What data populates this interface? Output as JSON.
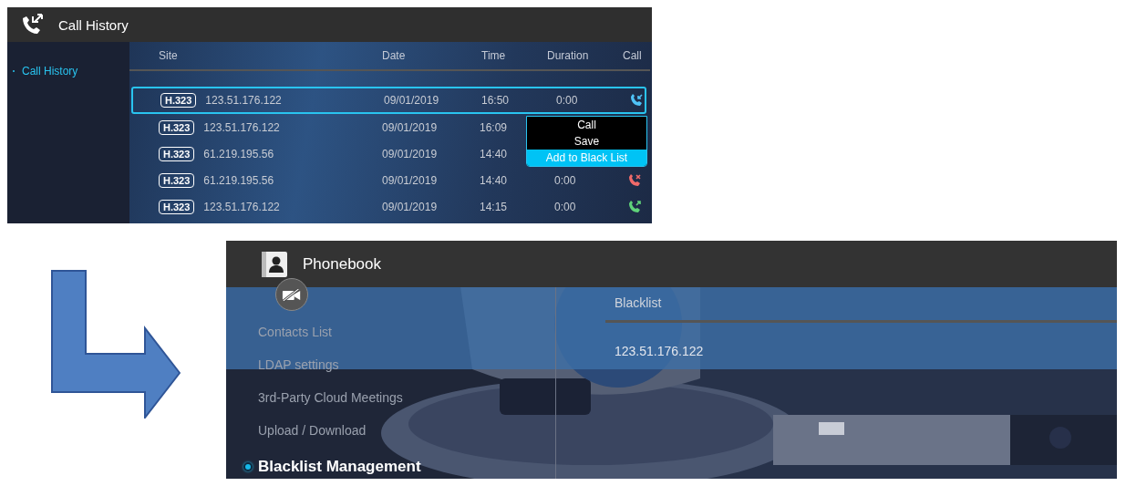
{
  "call_history": {
    "title": "Call History",
    "sidebar": [
      {
        "label": "Call History",
        "selected": true
      }
    ],
    "columns": [
      "Site",
      "Date",
      "Time",
      "Duration",
      "Call"
    ],
    "rows": [
      {
        "protocol": "H.323",
        "site": "123.51.176.122",
        "date": "09/01/2019",
        "time": "16:50",
        "duration": "0:00",
        "kind": "incoming",
        "selected": true
      },
      {
        "protocol": "H.323",
        "site": "123.51.176.122",
        "date": "09/01/2019",
        "time": "16:09",
        "selected": false
      },
      {
        "protocol": "H.323",
        "site": "61.219.195.56",
        "date": "09/01/2019",
        "time": "14:40",
        "selected": false
      },
      {
        "protocol": "H.323",
        "site": "61.219.195.56",
        "date": "09/01/2019",
        "time": "14:40",
        "duration": "0:00",
        "kind": "missed",
        "selected": false
      },
      {
        "protocol": "H.323",
        "site": "123.51.176.122",
        "date": "09/01/2019",
        "time": "14:15",
        "duration": "0:00",
        "kind": "outgoing",
        "selected": false
      }
    ],
    "context_menu": [
      {
        "label": "Call",
        "selected": false
      },
      {
        "label": "Save",
        "selected": false
      },
      {
        "label": "Add to Black List",
        "selected": true
      }
    ]
  },
  "phonebook": {
    "title": "Phonebook",
    "sidebar": [
      {
        "label": "Contacts List",
        "selected": false
      },
      {
        "label": "LDAP settings",
        "selected": false
      },
      {
        "label": "3rd-Party Cloud Meetings",
        "selected": false
      },
      {
        "label": "Upload / Download",
        "selected": false
      },
      {
        "label": "Blacklist Management",
        "selected": true
      }
    ],
    "column": "Blacklist",
    "rows": [
      "123.51.176.122"
    ]
  }
}
